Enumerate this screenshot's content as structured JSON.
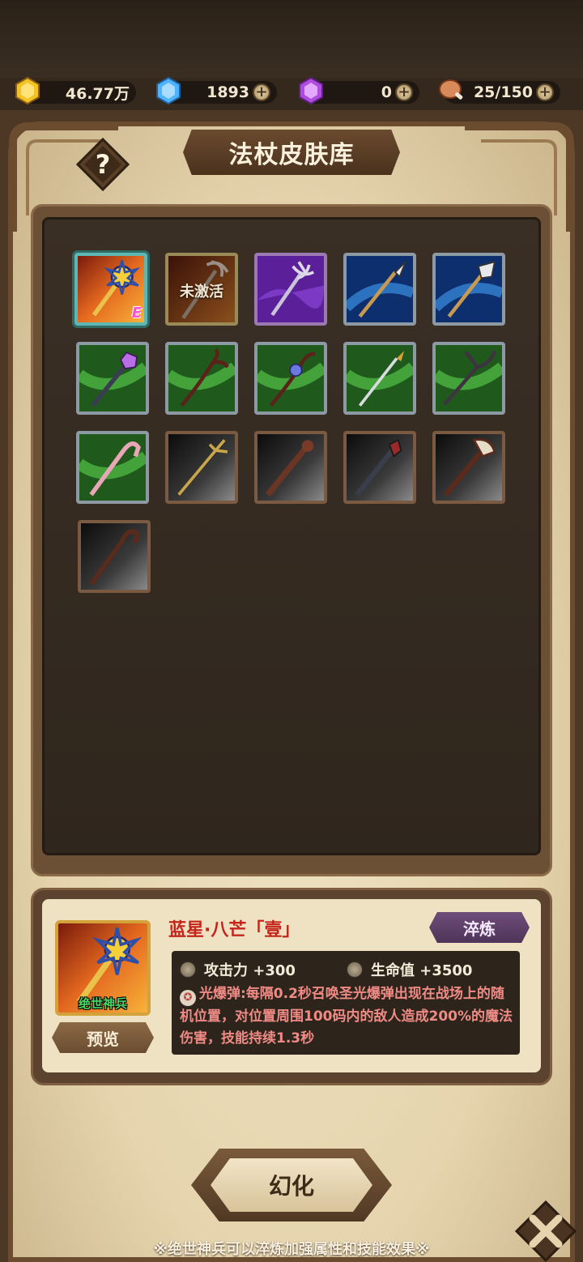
{
  "currencies": {
    "gold": {
      "value": "46.77万",
      "icon": "gold-coin-icon",
      "color": "#f2c321"
    },
    "diamond": {
      "value": "1893",
      "icon": "blue-gem-icon",
      "color": "#4fb3ff"
    },
    "purple_gem": {
      "value": "0",
      "icon": "purple-gem-icon",
      "color": "#b04be0"
    },
    "stamina": {
      "value": "25/150",
      "icon": "meat-icon",
      "color": "#d98a5a"
    },
    "plus_symbol": "+"
  },
  "header": {
    "title": "法杖皮肤库",
    "help_icon": "question-mark-icon"
  },
  "skins": [
    {
      "id": "star",
      "theme": "orange",
      "selected": true,
      "equipped_badge": "E"
    },
    {
      "id": "bone",
      "theme": "orange-dim",
      "locked_label": "未激活"
    },
    {
      "id": "trident-purple",
      "theme": "purple"
    },
    {
      "id": "spear-blue",
      "theme": "blue"
    },
    {
      "id": "axe-blue",
      "theme": "blue"
    },
    {
      "id": "gem-green",
      "theme": "green"
    },
    {
      "id": "root-green",
      "theme": "green"
    },
    {
      "id": "flower-green",
      "theme": "green"
    },
    {
      "id": "spear-green",
      "theme": "green"
    },
    {
      "id": "fork-green",
      "theme": "green"
    },
    {
      "id": "candy-green",
      "theme": "green"
    },
    {
      "id": "fork-gray",
      "theme": "gray"
    },
    {
      "id": "club-gray",
      "theme": "gray"
    },
    {
      "id": "mace-gray",
      "theme": "gray"
    },
    {
      "id": "hammer-gray",
      "theme": "gray"
    },
    {
      "id": "crook-gray",
      "theme": "gray"
    }
  ],
  "detail": {
    "name": "蓝星·八芒「壹」",
    "rank": "绝世神兵",
    "preview_label": "预览",
    "refine_label": "淬炼",
    "stats": [
      {
        "label": "攻击力 +300"
      },
      {
        "label": "生命值 +3500"
      }
    ],
    "skill_icon": "star-icon",
    "skill_text": "光爆弹:每隔0.2秒召唤圣光爆弹出现在战场上的随机位置，对位置周围100码内的敌人造成200%的魔法伤害，技能持续1.3秒"
  },
  "transform_label": "幻化",
  "close_icon": "close-x-icon",
  "footnote": "※绝世神兵可以淬炼加强属性和技能效果※"
}
